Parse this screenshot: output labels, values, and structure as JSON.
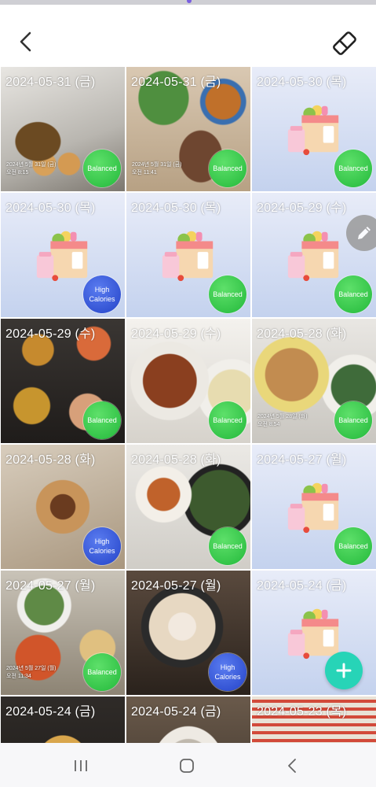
{
  "header": {
    "back_icon": "chevron-left-icon",
    "eraser_icon": "eraser-icon"
  },
  "colors": {
    "balanced": "#2ecc40",
    "high_calories": "#2e4fd6",
    "fab": "#27d4b7",
    "placeholder_bg": "#c4d2ee"
  },
  "tiles": [
    {
      "date": "2024-05-31 (금)",
      "badge": "Balanced",
      "kind": "photo",
      "stamp": [
        "2024년 5월 31일 (금)",
        "오전 8:15"
      ]
    },
    {
      "date": "2024-05-31 (금)",
      "badge": "Balanced",
      "kind": "photo",
      "stamp": [
        "2024년 5월 31일 (금)",
        "오전 11:41"
      ]
    },
    {
      "date": "2024-05-30 (목)",
      "badge": "Balanced",
      "kind": "placeholder"
    },
    {
      "date": "2024-05-30 (목)",
      "badge": "High\nCalories",
      "kind": "placeholder"
    },
    {
      "date": "2024-05-30 (목)",
      "badge": "Balanced",
      "kind": "placeholder"
    },
    {
      "date": "2024-05-29 (수)",
      "badge": "Balanced",
      "kind": "placeholder"
    },
    {
      "date": "2024-05-29 (수)",
      "badge": "Balanced",
      "kind": "photo"
    },
    {
      "date": "2024-05-29 (수)",
      "badge": "Balanced",
      "kind": "photo"
    },
    {
      "date": "2024-05-28 (화)",
      "badge": "Balanced",
      "kind": "photo",
      "stamp": [
        "2024년 5월 28일 (화)",
        "오전 8:54"
      ]
    },
    {
      "date": "2024-05-28 (화)",
      "badge": "High\nCalories",
      "kind": "photo"
    },
    {
      "date": "2024-05-28 (화)",
      "badge": "Balanced",
      "kind": "photo"
    },
    {
      "date": "2024-05-27 (월)",
      "badge": "Balanced",
      "kind": "placeholder"
    },
    {
      "date": "2024-05-27 (월)",
      "badge": "Balanced",
      "kind": "photo",
      "stamp": [
        "2024년 5월 27일 (월)",
        "오전 11:34"
      ]
    },
    {
      "date": "2024-05-27 (월)",
      "badge": "High\nCalories",
      "kind": "photo"
    },
    {
      "date": "2024-05-24 (금)",
      "badge": "",
      "kind": "placeholder"
    },
    {
      "date": "2024-05-24 (금)",
      "badge": "",
      "kind": "photo"
    },
    {
      "date": "2024-05-24 (금)",
      "badge": "",
      "kind": "photo"
    },
    {
      "date": "2024-05-23 (목)",
      "badge": "",
      "kind": "photo"
    }
  ],
  "fab": {
    "edit_icon": "pencil-icon",
    "add_icon": "plus-icon"
  },
  "navbar": {
    "recents_icon": "recents-icon",
    "home_icon": "home-icon",
    "back_icon": "back-icon"
  }
}
